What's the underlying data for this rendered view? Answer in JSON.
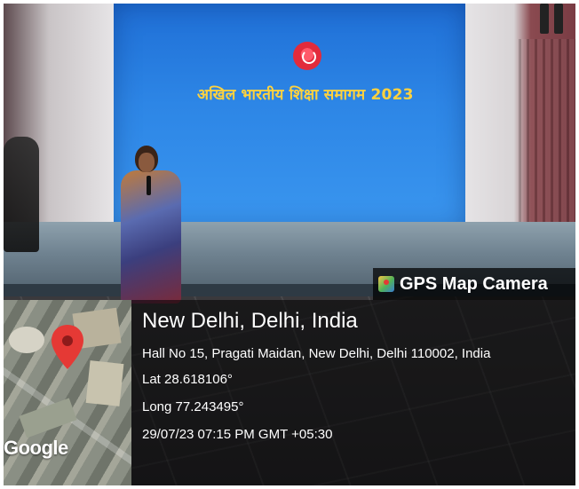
{
  "screen": {
    "title": "अखिल भारतीय शिक्षा समागम 2023"
  },
  "gps_badge": {
    "label": "GPS Map Camera",
    "icon": "gps-map-camera-icon"
  },
  "location": {
    "place": "New Delhi, Delhi, India",
    "address": "Hall No 15, Pragati Maidan, New Delhi, Delhi 110002, India",
    "latitude": "Lat 28.618106°",
    "longitude": "Long 77.243495°",
    "timestamp": "29/07/23 07:15 PM GMT +05:30"
  },
  "map": {
    "attribution": "Google",
    "pin_icon": "location-pin-icon",
    "pin_color": "#e53935"
  },
  "colors": {
    "screen_blue": "#2d86e6",
    "title_yellow": "#ffd23f",
    "overlay": "#000000"
  }
}
